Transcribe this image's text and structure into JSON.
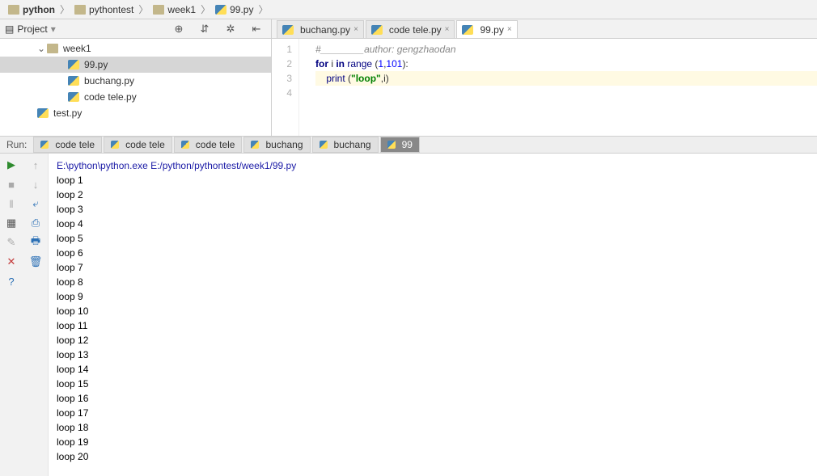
{
  "breadcrumbs": [
    {
      "label": "python",
      "type": "folder"
    },
    {
      "label": "pythontest",
      "type": "folder"
    },
    {
      "label": "week1",
      "type": "folder"
    },
    {
      "label": "99.py",
      "type": "py"
    }
  ],
  "project": {
    "title": "Project",
    "tree": [
      {
        "label": "week1",
        "type": "folder",
        "level": 1,
        "expanded": true
      },
      {
        "label": "99.py",
        "type": "py",
        "level": 2,
        "selected": true
      },
      {
        "label": "buchang.py",
        "type": "py",
        "level": 2
      },
      {
        "label": "code tele.py",
        "type": "py",
        "level": 2
      },
      {
        "label": "test.py",
        "type": "py",
        "level": 1
      }
    ]
  },
  "editor_tabs": [
    {
      "label": "buchang.py",
      "active": false
    },
    {
      "label": "code tele.py",
      "active": false
    },
    {
      "label": "99.py",
      "active": true
    }
  ],
  "code": {
    "lines": [
      {
        "n": 1,
        "segs": [
          {
            "cls": "c-gray",
            "t": "#________author: gengzhaodan"
          }
        ]
      },
      {
        "n": 2,
        "segs": []
      },
      {
        "n": 3,
        "segs": [
          {
            "cls": "c-kw",
            "t": "for "
          },
          {
            "cls": "",
            "t": "i "
          },
          {
            "cls": "c-kw",
            "t": "in "
          },
          {
            "cls": "c-builtin",
            "t": "range "
          },
          {
            "cls": "",
            "t": "("
          },
          {
            "cls": "c-num",
            "t": "1"
          },
          {
            "cls": "",
            "t": ","
          },
          {
            "cls": "c-num",
            "t": "101"
          },
          {
            "cls": "",
            "t": "):"
          }
        ]
      },
      {
        "n": 4,
        "segs": [
          {
            "cls": "",
            "t": "    "
          },
          {
            "cls": "c-builtin",
            "t": "print "
          },
          {
            "cls": "",
            "t": "("
          },
          {
            "cls": "c-str",
            "t": "\"loop\""
          },
          {
            "cls": "",
            "t": ",i)"
          }
        ],
        "caret": true
      }
    ]
  },
  "run_label": "Run:",
  "run_tabs": [
    {
      "label": "code tele"
    },
    {
      "label": "code tele"
    },
    {
      "label": "code tele"
    },
    {
      "label": "buchang"
    },
    {
      "label": "buchang"
    },
    {
      "label": "99",
      "active": true
    }
  ],
  "console": {
    "command": "E:\\python\\python.exe E:/python/pythontest/week1/99.py",
    "lines": [
      "loop 1",
      "loop 2",
      "loop 3",
      "loop 4",
      "loop 5",
      "loop 6",
      "loop 7",
      "loop 8",
      "loop 9",
      "loop 10",
      "loop 11",
      "loop 12",
      "loop 13",
      "loop 14",
      "loop 15",
      "loop 16",
      "loop 17",
      "loop 18",
      "loop 19",
      "loop 20"
    ]
  }
}
